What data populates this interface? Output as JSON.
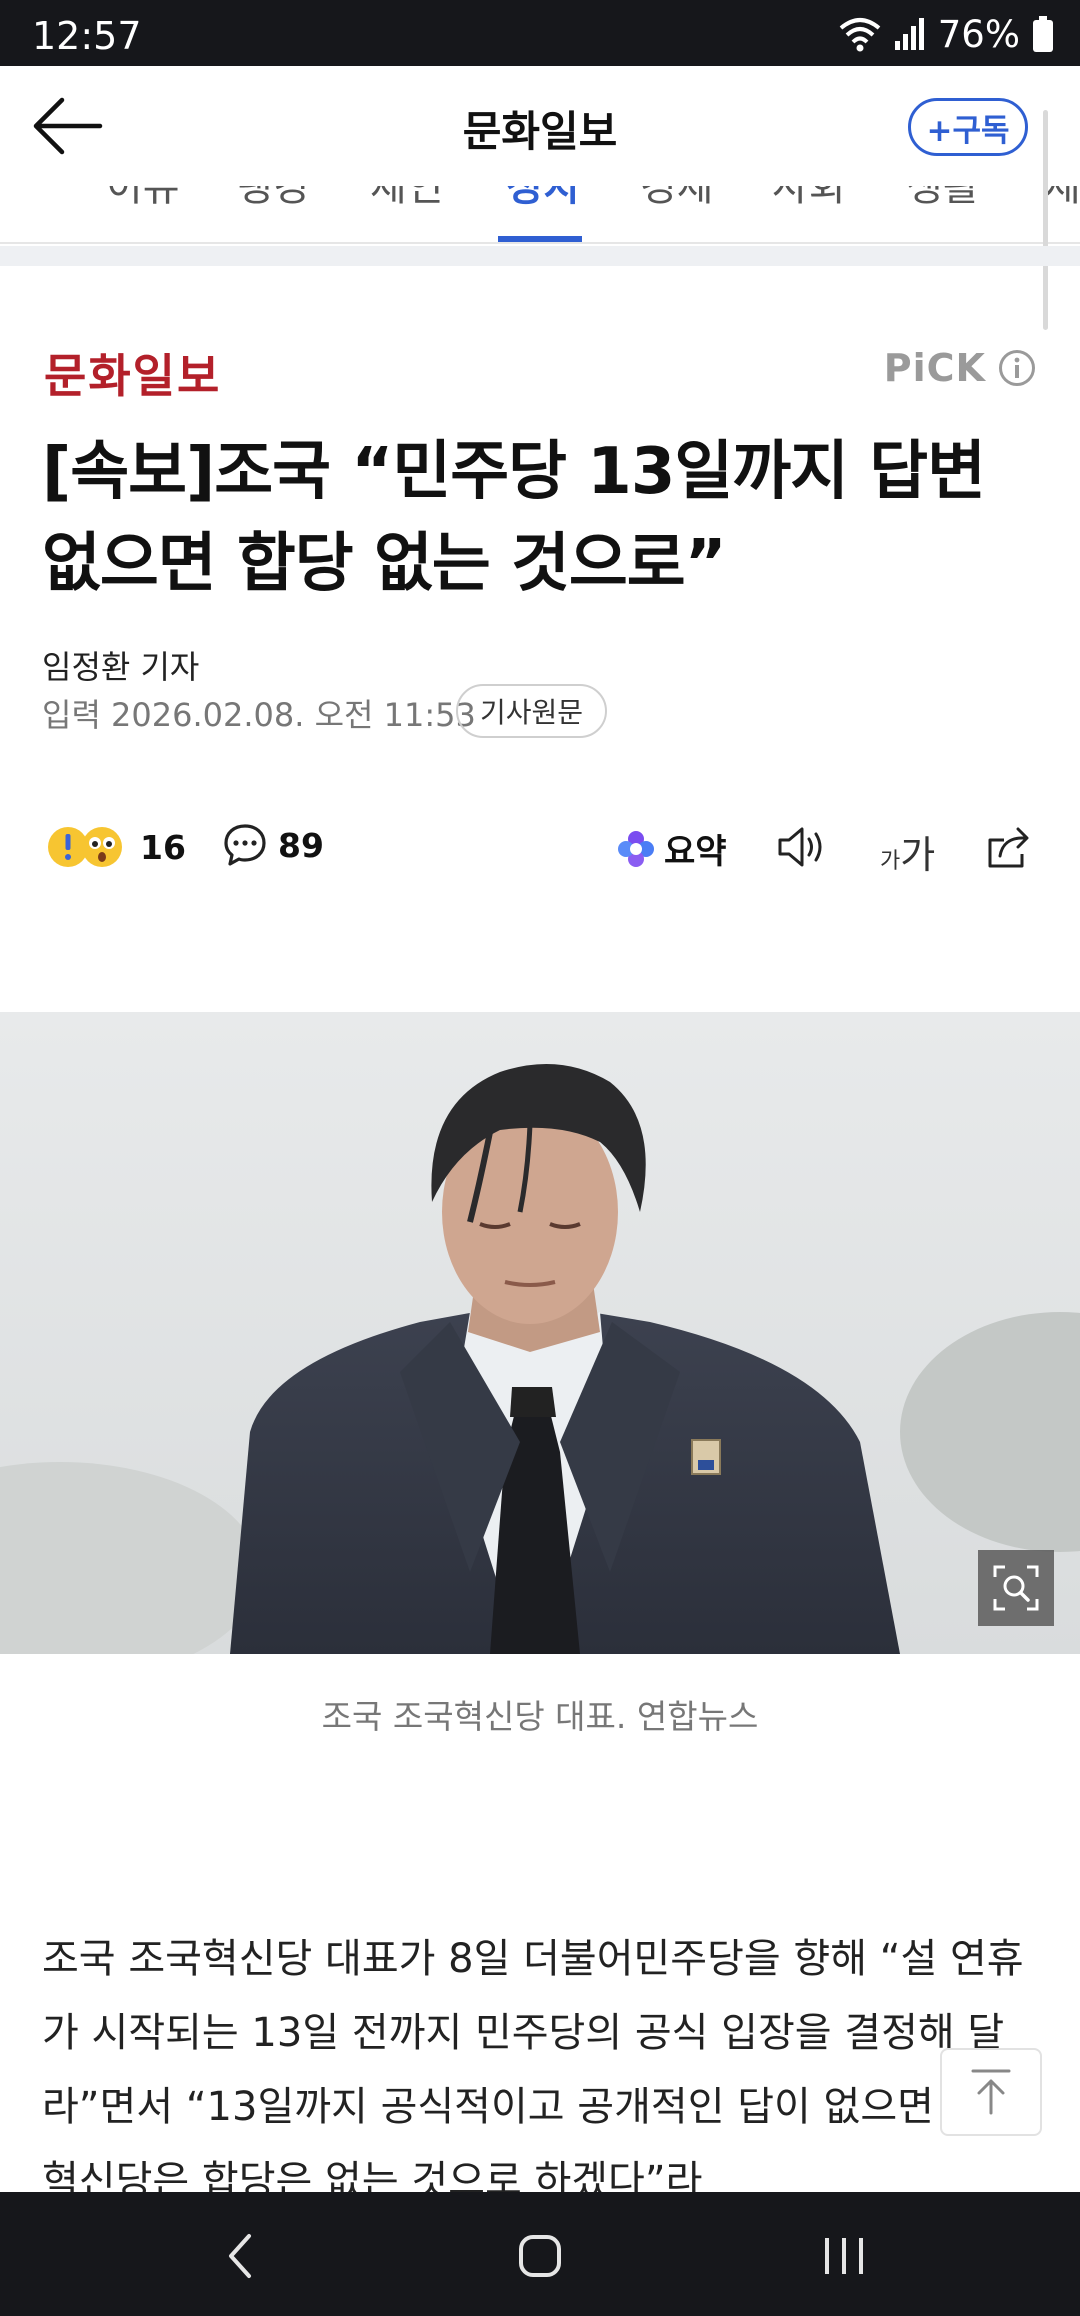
{
  "status_bar": {
    "time": "12:57",
    "battery": "76%"
  },
  "header": {
    "title": "문화일보",
    "subscribe_label": "+구독"
  },
  "tabs": [
    {
      "label": "—"
    },
    {
      "label": "이슈"
    },
    {
      "label": "랭킹"
    },
    {
      "label": "제인"
    },
    {
      "label": "정치"
    },
    {
      "label": "경제"
    },
    {
      "label": "사회"
    },
    {
      "label": "생활"
    },
    {
      "label": "세"
    }
  ],
  "article": {
    "press_logo": "문화일보",
    "pick_label": "PiCK",
    "headline": "[속보]조국 “민주당 13일까지 답변 없으면 합당 없는 것으로”",
    "author": "임정환 기자",
    "dateline": "입력 2026.02.08. 오전 11:53",
    "original_button": "기사원문",
    "reaction_count": "16",
    "comment_count": "89",
    "summary_label": "요약",
    "font_small": "가",
    "font_big": "가",
    "photo_caption": "조국 조국혁신당 대표. 연합뉴스",
    "body": "조국 조국혁신당 대표가 8일 더불어민주당을 향해 “설 연휴가 시작되는 13일 전까지 민주당의 공식 입장을 결정해 달라”면서 “13일까지 공식적이고 공개적인 답이 없으면 조국혁신당은 합당은 없는 것으로 하겠다”라"
  },
  "colors": {
    "accent": "#2f5fd2",
    "press_red": "#b3202a",
    "system_bar": "#16171b"
  }
}
